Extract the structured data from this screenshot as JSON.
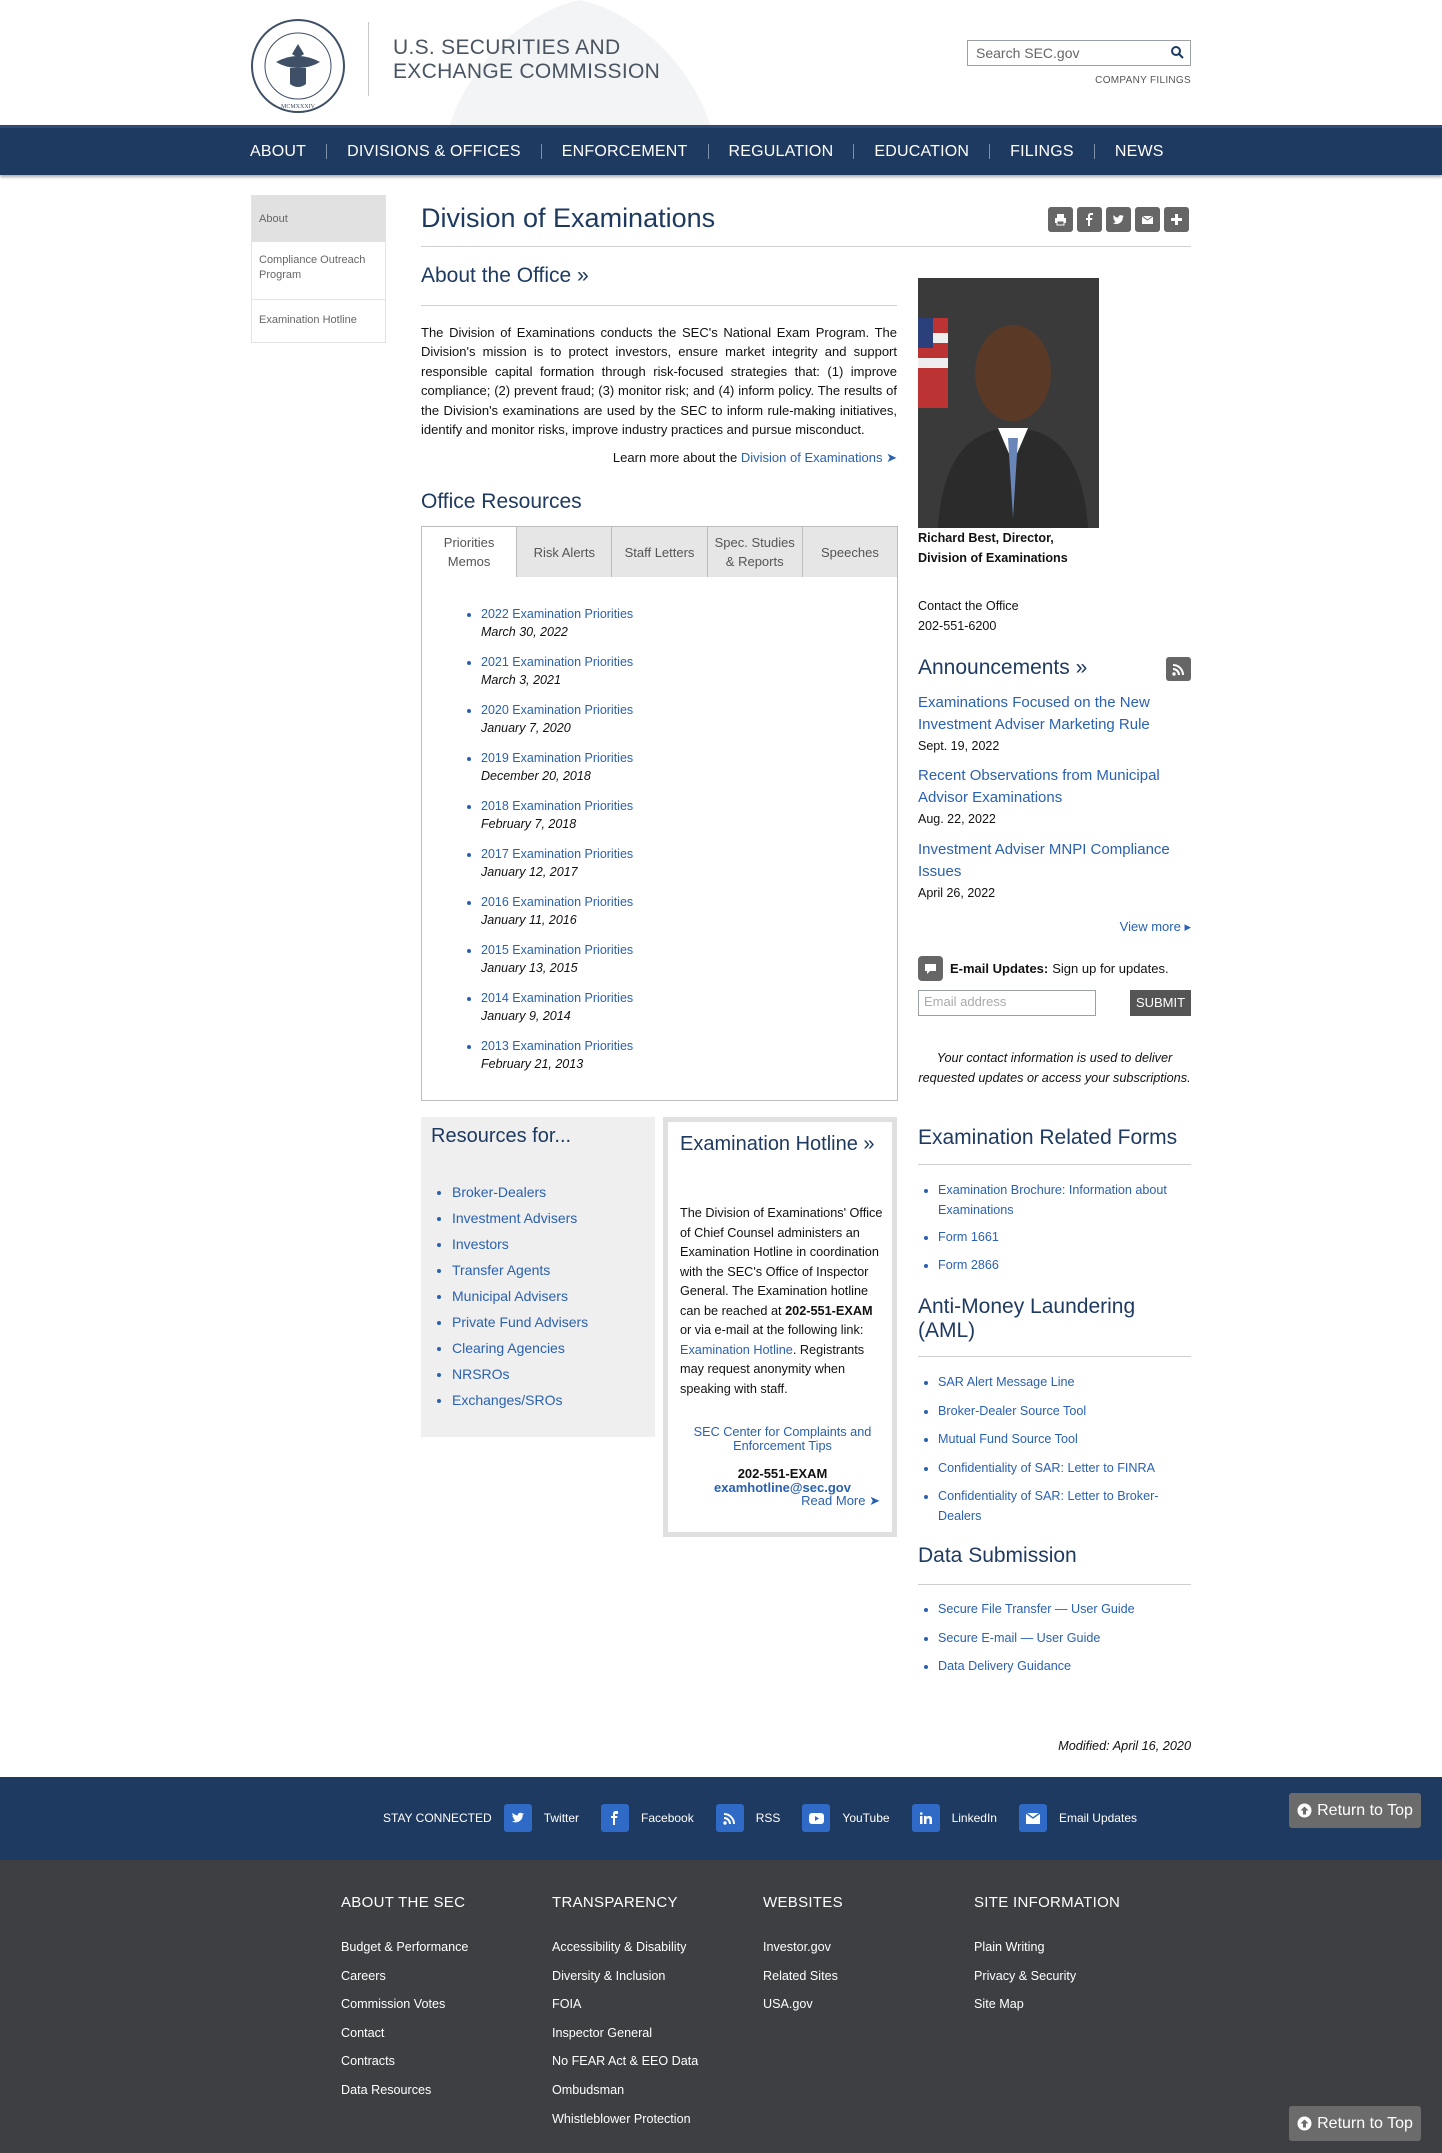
{
  "header": {
    "brand_line1": "U.S. SECURITIES AND",
    "brand_line2": "EXCHANGE COMMISSION",
    "seal_text": "SECURITIES AND EXCHANGE COMMISSION",
    "search_placeholder": "Search SEC.gov",
    "company_filings": "COMPANY FILINGS"
  },
  "nav": {
    "items": [
      "ABOUT",
      "DIVISIONS & OFFICES",
      "ENFORCEMENT",
      "REGULATION",
      "EDUCATION",
      "FILINGS",
      "NEWS"
    ]
  },
  "sidenav": {
    "items": [
      "About",
      "Compliance Outreach Program",
      "Examination Hotline"
    ]
  },
  "page": {
    "title": "Division of Examinations",
    "about_heading": "About the Office »",
    "about_text": "The Division of Examinations conducts the SEC's National Exam Program. The Division's mission is to protect investors, ensure market integrity and support responsible capital formation through risk-focused strategies that: (1) improve compliance; (2) prevent fraud; (3) monitor risk; and (4) inform policy. The results of the Division's examinations are used by the SEC to inform rule-making initiatives, identify and monitor risks, improve industry practices and pursue misconduct.",
    "learn_more_prefix": "Learn more about the",
    "learn_more_link": "Division of Examinations",
    "resources_heading": "Office Resources",
    "tabs": [
      "Priorities Memos",
      "Risk Alerts",
      "Staff Letters",
      "Spec. Studies & Reports",
      "Speeches"
    ],
    "priorities": [
      {
        "title": "2022 Examination Priorities",
        "date": "March 30, 2022"
      },
      {
        "title": "2021 Examination Priorities",
        "date": "March 3, 2021"
      },
      {
        "title": "2020 Examination Priorities",
        "date": "January 7, 2020"
      },
      {
        "title": "2019 Examination Priorities",
        "date": "December 20, 2018"
      },
      {
        "title": "2018 Examination Priorities",
        "date": "February 7, 2018"
      },
      {
        "title": "2017 Examination Priorities",
        "date": "January 12, 2017"
      },
      {
        "title": "2016 Examination Priorities",
        "date": "January 11, 2016"
      },
      {
        "title": "2015 Examination Priorities",
        "date": "January 13, 2015"
      },
      {
        "title": "2014 Examination Priorities",
        "date": "January 9, 2014"
      },
      {
        "title": "2013 Examination Priorities",
        "date": "February 21, 2013"
      }
    ]
  },
  "resources_for": {
    "heading": "Resources for...",
    "items": [
      "Broker-Dealers",
      "Investment Advisers",
      "Investors",
      "Transfer Agents",
      "Municipal Advisers",
      "Private Fund Advisers",
      "Clearing Agencies",
      "NRSROs",
      "Exchanges/SROs"
    ]
  },
  "hotline": {
    "heading": "Examination Hotline »",
    "text_part1": "The Division of Examinations' Office of Chief Counsel administers an Examination Hotline in coordination with the SEC's Office of Inspector General. The Examination hotline can be reached at",
    "phone_inline": "202-551-EXAM",
    "text_part2": "or via e-mail at the following link:",
    "link_text": "Examination Hotline",
    "text_part3": ". Registrants may request anonymity when speaking with staff.",
    "complaints_link": "SEC Center for Complaints and Enforcement Tips",
    "phone": "202-551-EXAM",
    "email": "examhotline@sec.gov",
    "read_more": "Read More"
  },
  "director": {
    "caption_line1": "Richard Best, Director,",
    "caption_line2": "Division of Examinations",
    "contact_label": "Contact the Office",
    "contact_phone": "202-551-6200"
  },
  "announcements": {
    "heading": "Announcements »",
    "items": [
      {
        "title": "Examinations Focused on the New Investment Adviser Marketing Rule",
        "date": "Sept. 19, 2022"
      },
      {
        "title": "Recent Observations from Municipal Advisor Examinations",
        "date": "Aug. 22, 2022"
      },
      {
        "title": "Investment Adviser MNPI Compliance Issues",
        "date": "April 26, 2022"
      }
    ],
    "view_more": "View more"
  },
  "email_updates": {
    "label_bold": "E-mail Updates:",
    "label_rest": "Sign up for updates.",
    "placeholder": "Email address",
    "submit": "SUBMIT",
    "privacy": "Your contact information is used to deliver requested updates or access your subscriptions."
  },
  "exam_forms": {
    "heading": "Examination Related Forms",
    "items": [
      "Examination Brochure: Information about Examinations",
      "Form 1661",
      "Form 2866"
    ]
  },
  "aml": {
    "heading": "Anti-Money Laundering (AML)",
    "items": [
      "SAR Alert Message Line",
      "Broker-Dealer Source Tool",
      "Mutual Fund Source Tool",
      "Confidentiality of SAR: Letter to FINRA",
      "Confidentiality of SAR: Letter to Broker-Dealers"
    ]
  },
  "data_submission": {
    "heading": "Data Submission",
    "items": [
      "Secure File Transfer — User Guide",
      "Secure E-mail — User Guide",
      "Data Delivery Guidance"
    ]
  },
  "modified": "Modified: April 16, 2020",
  "social": {
    "label": "STAY CONNECTED",
    "items": [
      {
        "name": "Twitter",
        "icon": "twitter-icon"
      },
      {
        "name": "Facebook",
        "icon": "facebook-icon"
      },
      {
        "name": "RSS",
        "icon": "rss-icon"
      },
      {
        "name": "YouTube",
        "icon": "youtube-icon"
      },
      {
        "name": "LinkedIn",
        "icon": "linkedin-icon"
      },
      {
        "name": "Email Updates",
        "icon": "email-icon"
      }
    ],
    "return_top": "Return to Top"
  },
  "footer": {
    "cols": [
      {
        "heading": "ABOUT THE SEC",
        "links": [
          "Budget & Performance",
          "Careers",
          "Commission Votes",
          "Contact",
          "Contracts",
          "Data Resources"
        ]
      },
      {
        "heading": "TRANSPARENCY",
        "links": [
          "Accessibility & Disability",
          "Diversity & Inclusion",
          "FOIA",
          "Inspector General",
          "No FEAR Act & EEO Data",
          "Ombudsman",
          "Whistleblower Protection"
        ]
      },
      {
        "heading": "WEBSITES",
        "links": [
          "Investor.gov",
          "Related Sites",
          "USA.gov"
        ]
      },
      {
        "heading": "SITE INFORMATION",
        "links": [
          "Plain Writing",
          "Privacy & Security",
          "Site Map"
        ]
      }
    ]
  },
  "colors": {
    "navy": "#1f3a60",
    "link": "#2a61b0",
    "footer": "#3d3f42",
    "social": "#2f6bc6"
  }
}
